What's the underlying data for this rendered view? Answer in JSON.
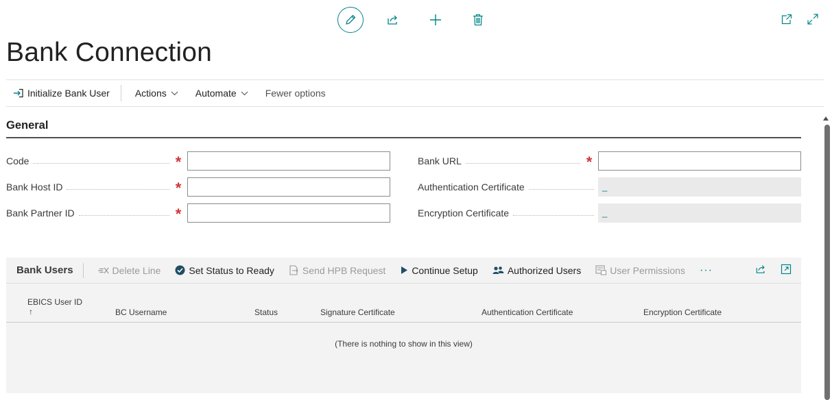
{
  "page": {
    "title": "Bank Connection"
  },
  "top_actions": {
    "edit_icon": "pencil-icon",
    "share_icon": "share-icon",
    "new_icon": "plus-icon",
    "delete_icon": "trash-icon",
    "open_new_window_icon": "open-in-new-window-icon",
    "expand_icon": "expand-icon"
  },
  "action_bar": {
    "initialize_label": "Initialize Bank User",
    "actions_label": "Actions",
    "automate_label": "Automate",
    "fewer_options_label": "Fewer options"
  },
  "general": {
    "title": "General",
    "fields_left": [
      {
        "label": "Code",
        "required": true,
        "value": ""
      },
      {
        "label": "Bank Host ID",
        "required": true,
        "value": ""
      },
      {
        "label": "Bank Partner ID",
        "required": true,
        "value": ""
      }
    ],
    "fields_right": [
      {
        "label": "Bank URL",
        "required": true,
        "value": ""
      },
      {
        "label": "Authentication Certificate",
        "required": false,
        "value": "_"
      },
      {
        "label": "Encryption Certificate",
        "required": false,
        "value": "_"
      }
    ]
  },
  "bank_users": {
    "title": "Bank Users",
    "actions": {
      "delete_line": "Delete Line",
      "set_status_ready": "Set Status to Ready",
      "send_hpb": "Send HPB Request",
      "continue_setup": "Continue Setup",
      "authorized_users": "Authorized Users",
      "user_permissions": "User Permissions",
      "more": "···"
    },
    "columns": {
      "ebics_user_id": "EBICS User ID",
      "sort_arrow": "↑",
      "bc_username": "BC Username",
      "status": "Status",
      "signature_certificate": "Signature Certificate",
      "authentication_certificate": "Authentication Certificate",
      "encryption_certificate": "Encryption Certificate"
    },
    "empty_message": "(There is nothing to show in this view)"
  },
  "colors": {
    "accent": "#008489",
    "required": "#d13438",
    "readonly_bg": "#eaeaea",
    "part_bg": "#f3f3f3"
  }
}
